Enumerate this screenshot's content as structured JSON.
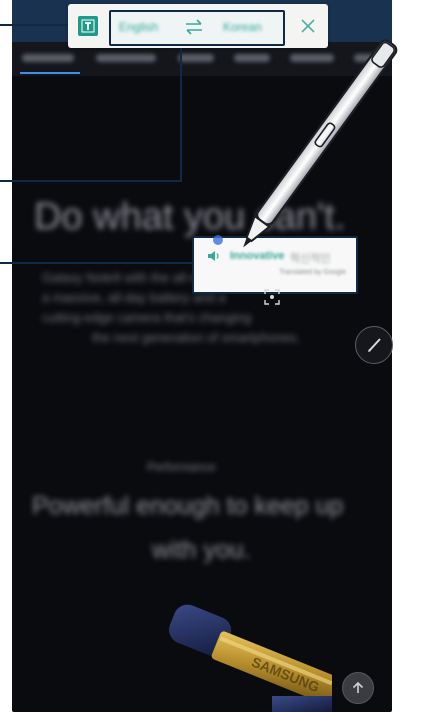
{
  "screen": {
    "headline": "Do what you can't.",
    "paragraph_lines": [
      "Galaxy Note9 with the all-new S Pen,",
      "a massive, all-day battery and a",
      "cutting-edge camera that's changing",
      "the next generation of smartphones."
    ],
    "section_label": "Performance",
    "powerful_line1": "Powerful enough to keep up",
    "powerful_line2": "with you."
  },
  "translate_bar": {
    "text_mode_icon": "t-text-icon",
    "source_language": "English",
    "target_language": "Korean",
    "swap_icon": "swap-arrows-icon",
    "close_icon": "close-icon"
  },
  "translation_popup": {
    "speaker_icon": "speaker-icon",
    "word": "Innovative",
    "translation": "혁신적인",
    "credit": "Translated by Google"
  },
  "colors": {
    "accent": "#1f9a8a",
    "callout": "#0e2a47",
    "screen_bg": "#0a0b0f"
  }
}
